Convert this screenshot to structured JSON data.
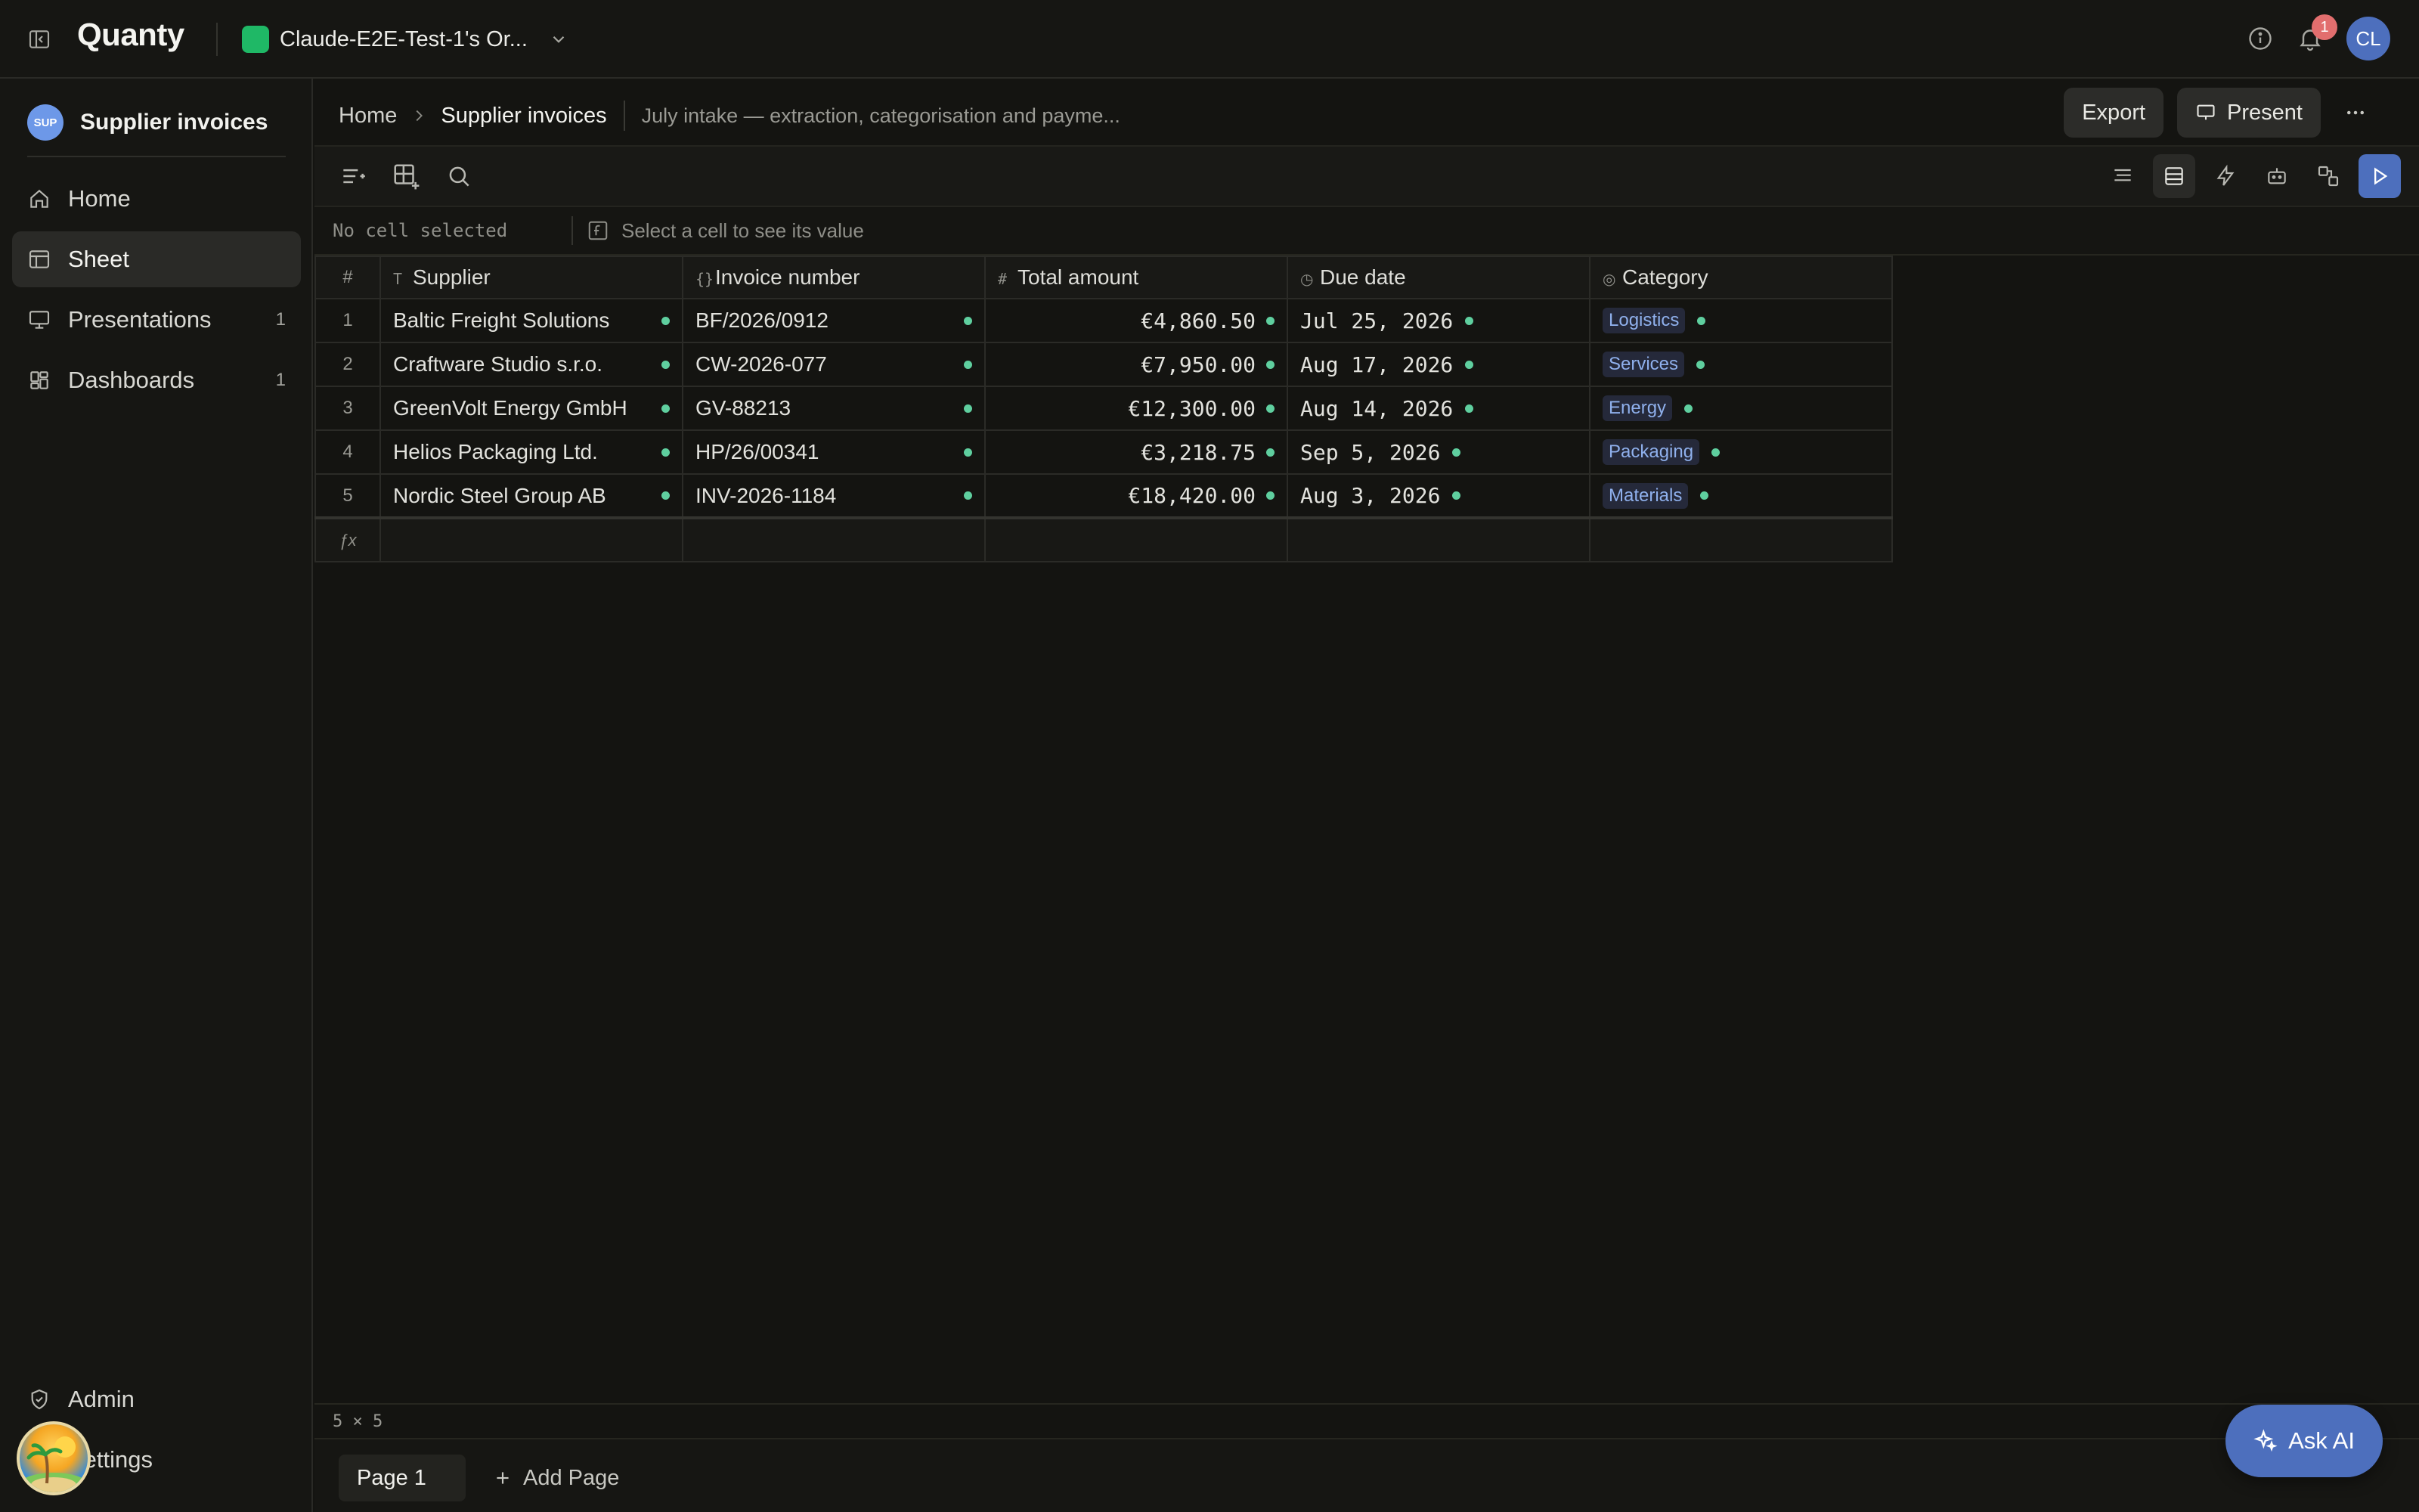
{
  "app": {
    "brand": "Quanty",
    "org_name": "Claude-E2E-Test-1's Or...",
    "notification_count": "1",
    "user_initials": "CL"
  },
  "sidebar": {
    "workspace_avatar": "SUP",
    "workspace_title": "Supplier invoices",
    "items": [
      {
        "label": "Home",
        "icon": "home-icon",
        "count": ""
      },
      {
        "label": "Sheet",
        "icon": "sheet-icon",
        "count": ""
      },
      {
        "label": "Presentations",
        "icon": "presentation-icon",
        "count": "1"
      },
      {
        "label": "Dashboards",
        "icon": "dashboard-icon",
        "count": "1"
      }
    ],
    "bottom_items": [
      {
        "label": "Admin",
        "icon": "shield-icon"
      },
      {
        "label": "Settings",
        "icon": "gear-icon"
      }
    ]
  },
  "header": {
    "breadcrumb_home": "Home",
    "breadcrumb_current": "Supplier invoices",
    "description": "July intake — extraction, categorisation and payme...",
    "export_label": "Export",
    "present_label": "Present"
  },
  "formula_bar": {
    "cell_ref": "No cell selected",
    "hint": "Select a cell to see its value"
  },
  "table": {
    "rownum_header": "#",
    "columns": [
      {
        "type_icon": "T",
        "label": "Supplier"
      },
      {
        "type_icon": "{}",
        "label": "Invoice number"
      },
      {
        "type_icon": "#",
        "label": "Total amount"
      },
      {
        "type_icon": "◷",
        "label": "Due date"
      },
      {
        "type_icon": "◎",
        "label": "Category"
      }
    ],
    "rows": [
      {
        "n": "1",
        "supplier": "Baltic Freight Solutions",
        "invoice": "BF/2026/0912",
        "amount": "€4,860.50",
        "due": "Jul 25, 2026",
        "category": "Logistics"
      },
      {
        "n": "2",
        "supplier": "Craftware Studio s.r.o.",
        "invoice": "CW-2026-077",
        "amount": "€7,950.00",
        "due": "Aug 17, 2026",
        "category": "Services"
      },
      {
        "n": "3",
        "supplier": "GreenVolt Energy GmbH",
        "invoice": "GV-88213",
        "amount": "€12,300.00",
        "due": "Aug 14, 2026",
        "category": "Energy"
      },
      {
        "n": "4",
        "supplier": "Helios Packaging Ltd.",
        "invoice": "HP/26/00341",
        "amount": "€3,218.75",
        "due": "Sep 5, 2026",
        "category": "Packaging"
      },
      {
        "n": "5",
        "supplier": "Nordic Steel Group AB",
        "invoice": "INV-2026-1184",
        "amount": "€18,420.00",
        "due": "Aug 3, 2026",
        "category": "Materials"
      }
    ],
    "formula_row_label": "ƒx"
  },
  "status": {
    "dimensions": "5 × 5"
  },
  "pages": {
    "current": "Page 1",
    "add_label": "Add Page"
  },
  "ask_ai_label": "Ask AI",
  "colors": {
    "accent": "#4d6fbd",
    "org_swatch": "#1fb866",
    "status_dot": "#5fcf9f",
    "badge": "#e26e6e"
  }
}
